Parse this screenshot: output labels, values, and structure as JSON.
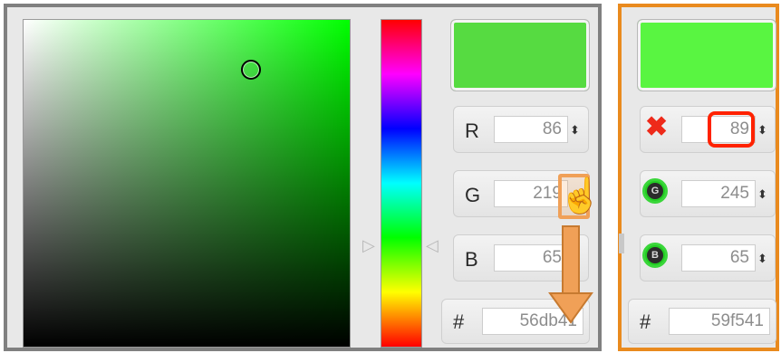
{
  "left_panel": {
    "channels": [
      {
        "label": "R",
        "value": "86"
      },
      {
        "label": "G",
        "value": "219"
      },
      {
        "label": "B",
        "value": "65"
      }
    ],
    "hex_label": "#",
    "hex_value": "56db41",
    "swatch_color": "#56db41"
  },
  "right_panel": {
    "channels": [
      {
        "icon": "red-x-icon",
        "value": "89"
      },
      {
        "icon": "green-g-icon",
        "glyph": "G",
        "value": "245"
      },
      {
        "icon": "green-b-icon",
        "glyph": "B",
        "value": "65"
      }
    ],
    "hex_label": "#",
    "hex_value": "59f541",
    "swatch_color": "#59f541"
  },
  "spinner_glyph": "⬍",
  "colors": {
    "frame_left": "#808080",
    "frame_right": "#e98a1e",
    "highlight_orange": "#f0a057",
    "highlight_red": "#ff2200"
  }
}
